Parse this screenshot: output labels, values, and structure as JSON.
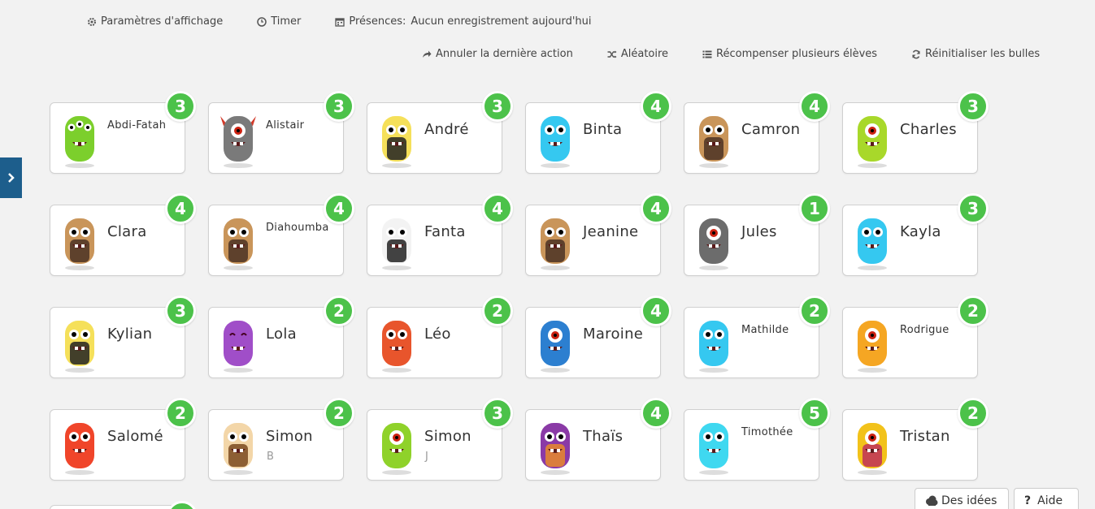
{
  "toolbar_top": {
    "display_settings": "Paramètres d'affichage",
    "timer": "Timer",
    "presence_label": "Présences:",
    "presence_value": "Aucun enregistrement aujourd'hui"
  },
  "toolbar_actions": {
    "undo": "Annuler la dernière action",
    "random": "Aléatoire",
    "reward_multiple": "Récompenser plusieurs élèves",
    "reset_bubbles": "Réinitialiser les bulles"
  },
  "students": [
    {
      "name": "Abdi-Fatah",
      "points": "3",
      "avatar": "green-three-eyed-monster"
    },
    {
      "name": "Alistair",
      "points": "3",
      "avatar": "grey-horned-cyclops"
    },
    {
      "name": "André",
      "points": "3",
      "avatar": "yellow-black-bear"
    },
    {
      "name": "Binta",
      "points": "4",
      "avatar": "blue-fuzzy-monster"
    },
    {
      "name": "Camron",
      "points": "4",
      "avatar": "brown-hamster"
    },
    {
      "name": "Charles",
      "points": "3",
      "avatar": "lime-cyclops"
    },
    {
      "name": "Clara",
      "points": "4",
      "avatar": "brown-hamster"
    },
    {
      "name": "Diahoumba",
      "points": "4",
      "avatar": "brown-hamster"
    },
    {
      "name": "Fanta",
      "points": "4",
      "avatar": "black-white-bear"
    },
    {
      "name": "Jeanine",
      "points": "4",
      "avatar": "brown-hamster"
    },
    {
      "name": "Jules",
      "points": "1",
      "avatar": "grey-cyclops"
    },
    {
      "name": "Kayla",
      "points": "3",
      "avatar": "blue-fuzzy-monster"
    },
    {
      "name": "Kylian",
      "points": "3",
      "avatar": "yellow-black-bear"
    },
    {
      "name": "Lola",
      "points": "2",
      "avatar": "purple-cat"
    },
    {
      "name": "Léo",
      "points": "2",
      "avatar": "red-fuzzy-monster"
    },
    {
      "name": "Maroine",
      "points": "4",
      "avatar": "blue-bird"
    },
    {
      "name": "Mathilde",
      "points": "2",
      "avatar": "blue-fuzzy-monster"
    },
    {
      "name": "Rodrigue",
      "points": "2",
      "avatar": "orange-cyclops"
    },
    {
      "name": "Salomé",
      "points": "2",
      "avatar": "red-reindeer-monster"
    },
    {
      "name": "Simon",
      "sub": "B",
      "points": "2",
      "avatar": "boy-with-hair"
    },
    {
      "name": "Simon",
      "sub": "J",
      "points": "3",
      "avatar": "lime-antenna-monster"
    },
    {
      "name": "Thaïs",
      "points": "4",
      "avatar": "purple-orange-monster"
    },
    {
      "name": "Timothée",
      "points": "5",
      "avatar": "cyan-tall-monster"
    },
    {
      "name": "Tristan",
      "points": "2",
      "avatar": "yellow-octopus-cyclops"
    }
  ],
  "bottom_buttons": {
    "ideas": "Des idées",
    "help": "Aide"
  },
  "colors": {
    "badge": "#4cc24a",
    "side_toggle": "#1d5e8c",
    "background": "#f2f2f2"
  }
}
